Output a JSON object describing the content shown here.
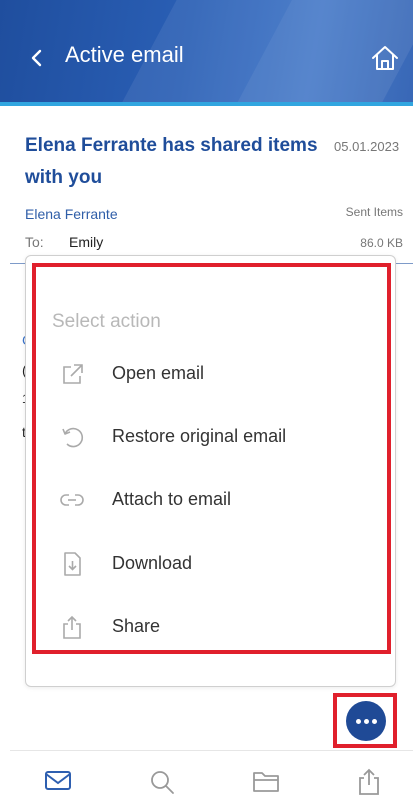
{
  "header": {
    "title": "Active email"
  },
  "email": {
    "subject": "Elena Ferrante has shared items with you",
    "date": "05.01.2023",
    "sender": "Elena Ferrante",
    "folder": "Sent Items",
    "to_label": "To:",
    "to_value": "Emily",
    "size": "86.0 KB"
  },
  "body_fragments": [
    "C",
    "(",
    "1",
    "t"
  ],
  "action_sheet": {
    "title": "Select action",
    "items": [
      {
        "label": "Open email",
        "icon": "open-external-icon"
      },
      {
        "label": "Restore original email",
        "icon": "restore-icon"
      },
      {
        "label": "Attach to email",
        "icon": "link-icon"
      },
      {
        "label": "Download",
        "icon": "download-file-icon"
      },
      {
        "label": "Share",
        "icon": "share-icon"
      }
    ]
  },
  "fab": {
    "icon": "more-dots-icon"
  },
  "bottom_nav": [
    {
      "name": "mail",
      "icon": "mail-icon",
      "active": true
    },
    {
      "name": "search",
      "icon": "search-icon",
      "active": false
    },
    {
      "name": "folders",
      "icon": "folder-icon",
      "active": false
    },
    {
      "name": "share",
      "icon": "share-icon",
      "active": false
    }
  ],
  "colors": {
    "header": "#2a5fb5",
    "accent_bar": "#31a6e0",
    "subject": "#1f4d9a",
    "highlight": "#e0202c",
    "fab": "#1f4a96"
  }
}
